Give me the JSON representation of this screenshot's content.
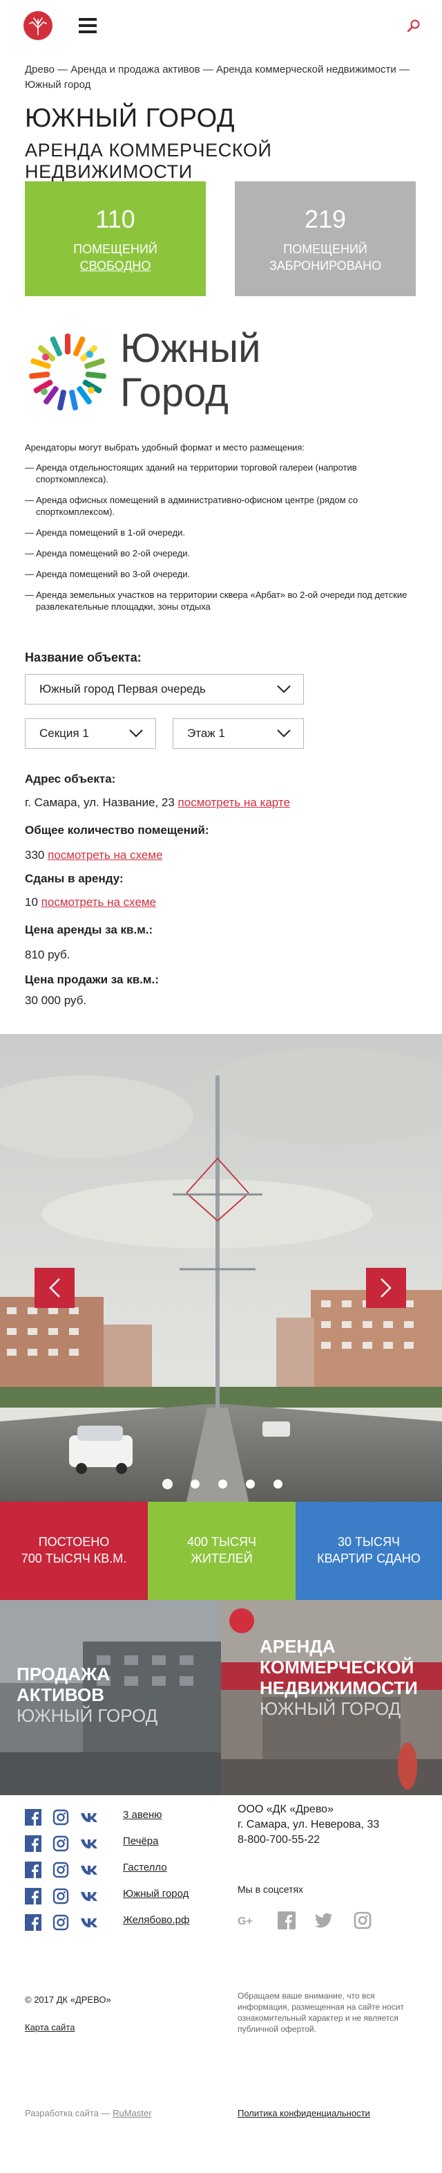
{
  "header": {
    "logo_icon": "company-tree-logo",
    "menu_icon": "hamburger-icon",
    "search_icon": "search-icon",
    "accent": "#d22f3d"
  },
  "breadcrumb": "Древо — Аренда и продажа активов — Аренда коммерческой недвижимости — Южный город",
  "title": "ЮЖНЫЙ ГОРОД",
  "subtitle": "АРЕНДА КОММЕРЧЕСКОЙ НЕДВИЖИМОСТИ",
  "stats": {
    "free": {
      "number": "110",
      "label": "ПОМЕЩЕНИЙ",
      "link": "СВОБОДНО",
      "color": "#8cc43c"
    },
    "booked": {
      "number": "219",
      "label": "ПОМЕЩЕНИЙ",
      "sub": "ЗАБРОНИРОВАНО",
      "color": "#b3b3b3"
    }
  },
  "project_logo": {
    "line1": "Южный",
    "line2": "Город"
  },
  "intro": {
    "lead": "Арендаторы могут выбрать удобный формат и место размещения:",
    "items": [
      "Аренда отдельностоящих зданий на территории торговой галереи (напротив спорткомплекса).",
      "Аренда офисных помещений  в административно-офисном центре (рядом со спорткомплексом).",
      "Аренда помещений в 1-ой очереди.",
      "Аренда помещений во 2-ой очереди.",
      "Аренда помещений во 3-ой очереди.",
      "Аренда земельных участков на территории сквера «Арбат» во 2-ой очереди под детские развлекательные площадки, зоны отдыха"
    ]
  },
  "filters": {
    "object_label": "Название объекта:",
    "object_value": "Южный город Первая очередь",
    "section_value": "Секция 1",
    "floor_value": "Этаж 1"
  },
  "info": {
    "address_label": "Адрес объекта:",
    "address_value": "г. Самара, ул. Название, 23",
    "address_link": "посмотреть на карте",
    "total_label": "Общее количество помещений:",
    "total_value": "330",
    "total_link": "посмотреть на схеме",
    "rented_label": "Сданы в аренду:",
    "rented_value": "10",
    "rented_link": "посмотреть на схеме",
    "rent_price_label": "Цена аренды за кв.м.:",
    "rent_price_value": "810 руб.",
    "sale_price_label": "Цена продажи за кв.м.:",
    "sale_price_value": "30 000 руб."
  },
  "slider": {
    "prev_icon": "chevron-left-icon",
    "next_icon": "chevron-right-icon",
    "dots": 5,
    "active_dot": 1
  },
  "kpis": [
    {
      "line1": "ПОСТОЕНО",
      "line2": "700 ТЫСЯЧ КВ.М.",
      "color": "#c8263a"
    },
    {
      "line1": "400 ТЫСЯЧ",
      "line2": "ЖИТЕЛЕЙ",
      "color": "#8cc43c"
    },
    {
      "line1": "30 ТЫСЯЧ",
      "line2": "КВАРТИР СДАНО",
      "color": "#3c7dc7"
    }
  ],
  "promos": {
    "left": {
      "line1": "ПРОДАЖА",
      "line2": "АКТИВОВ",
      "sub": "ЮЖНЫЙ ГОРОД"
    },
    "right": {
      "line1": "АРЕНДА",
      "line2": "КОММЕРЧЕСКОЙ",
      "line3": "НЕДВИЖИМОСТИ",
      "sub": "ЮЖНЫЙ ГОРОД"
    }
  },
  "footer": {
    "projects": [
      "3 авеню",
      "Печёра",
      "Гастелло",
      "Южный город",
      "Желябово.рф"
    ],
    "company": "ООО «ДК «Древо»",
    "address": "г. Самара, ул. Неверова, 33",
    "phone": "8-800-700-55-22",
    "social_label": "Мы в соцсетях",
    "copyright": "© 2017 ДК «ДРЕВО»",
    "sitemap": "Карта сайта",
    "notice": "Обращаем ваше внимание, что вся информация, размещенная на сайте носит ознакомительный характер и не является публичной офертой.",
    "developer_prefix": "Разработка сайта —",
    "developer_link": "RuMaster",
    "privacy": "Политика конфиденциальности"
  }
}
